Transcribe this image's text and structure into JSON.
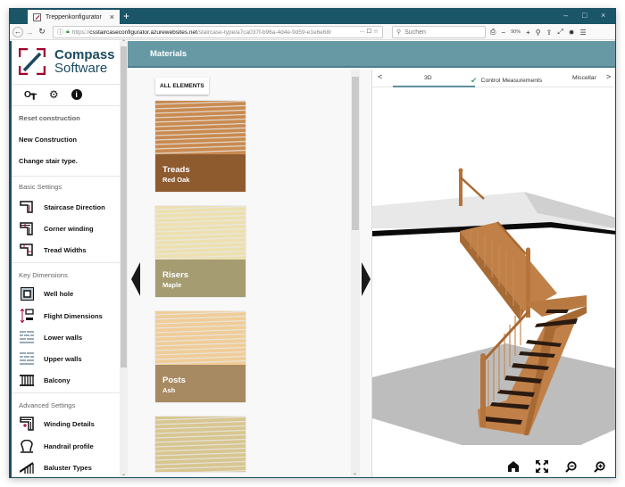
{
  "browser": {
    "tab_title": "Treppenkonfigurator",
    "tab_close": "×",
    "new_tab": "+",
    "url_prefix": "https://",
    "url_host": "csstaircaseconfigurator.azurewebsites.net",
    "url_path": "/staircase-type/a7ca037f-b96a-4d4e-9d59-e1e6e68r",
    "url_tail": "··· ☐ ☆",
    "search_placeholder": "Suchen",
    "zoom_level": "90%",
    "window_controls": [
      "–",
      "□",
      "×"
    ]
  },
  "sidebar": {
    "logo_line1": "Compass",
    "logo_line2": "Software",
    "top_actions": [
      {
        "label": "Reset construction",
        "muted": true
      },
      {
        "label": "New Construction"
      },
      {
        "label": "Change stair type."
      }
    ],
    "sections": [
      {
        "title": "Basic Settings",
        "items": [
          {
            "label": "Staircase Direction",
            "icon": "staircase-direction-icon"
          },
          {
            "label": "Corner winding",
            "icon": "corner-winding-icon"
          },
          {
            "label": "Tread Widths",
            "icon": "tread-widths-icon"
          }
        ]
      },
      {
        "title": "Key Dimensions",
        "items": [
          {
            "label": "Well hole",
            "icon": "well-hole-icon"
          },
          {
            "label": "Flight Dimensions",
            "icon": "flight-dimensions-icon"
          },
          {
            "label": "Lower walls",
            "icon": "lower-walls-icon"
          },
          {
            "label": "Upper walls",
            "icon": "upper-walls-icon"
          },
          {
            "label": "Balcony",
            "icon": "balcony-icon"
          }
        ]
      },
      {
        "title": "Advanced Settings",
        "items": [
          {
            "label": "Winding Details",
            "icon": "winding-details-icon"
          },
          {
            "label": "Handrail profile",
            "icon": "handrail-profile-icon"
          },
          {
            "label": "Baluster Types",
            "icon": "baluster-types-icon"
          }
        ]
      }
    ]
  },
  "main": {
    "header_title": "Materials",
    "all_elements_label": "ALL ELEMENTS",
    "materials": [
      {
        "name": "Treads",
        "wood": "Red Oak",
        "color_top": "#c98a50",
        "color_band": "#8e5b2f"
      },
      {
        "name": "Risers",
        "wood": "Maple",
        "color_top": "#ece0b0",
        "color_band": "#a59c72"
      },
      {
        "name": "Posts",
        "wood": "Ash",
        "color_top": "#f0cc98",
        "color_band": "#a88a62"
      },
      {
        "name": "",
        "wood": "",
        "color_top": "#d8c690",
        "color_band": "#d0bc86"
      }
    ]
  },
  "viewer": {
    "tabs": [
      {
        "label": "3D",
        "active": true
      },
      {
        "label": "Control Measurements",
        "checked": true
      },
      {
        "label": "Miscellar"
      }
    ],
    "prev": "<",
    "next": ">",
    "tools": [
      "home-view",
      "fullscreen",
      "zoom-out",
      "zoom-in"
    ]
  },
  "colors": {
    "header": "#6799a5",
    "titlebar": "#1a5568",
    "brand": "#1c4a60",
    "logo_red": "#a4002d"
  }
}
